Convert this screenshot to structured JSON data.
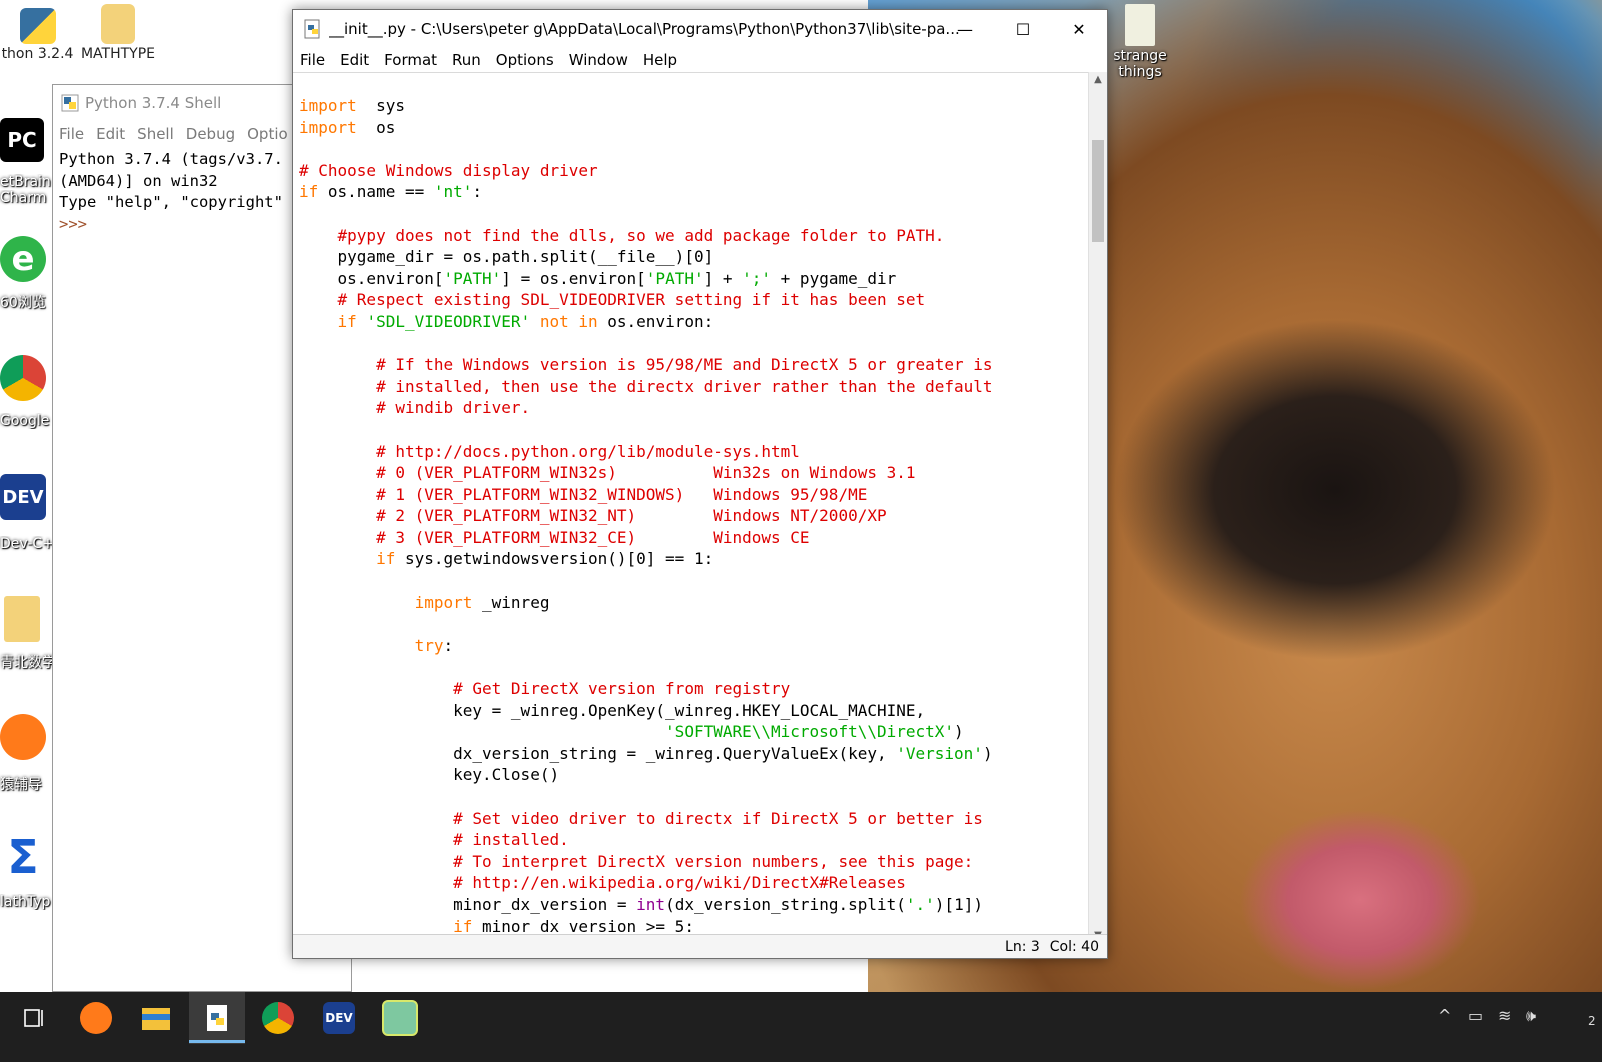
{
  "desktop": {
    "top_icons": [
      {
        "label": "thon 3.2.4",
        "icon": "python-icon"
      },
      {
        "label": "MATHTYPE",
        "icon": "folder-icon"
      }
    ],
    "right_icons": [
      {
        "label_line1": "strange",
        "label_line2": "things",
        "icon": "book-icon"
      }
    ],
    "left_icons": [
      {
        "label_line1": "etBrain",
        "label_line2": "Charm",
        "glyph": "PC",
        "icon": "pycharm-icon"
      },
      {
        "label_line1": "60浏览",
        "glyph": "e",
        "icon": "browser-360-icon"
      },
      {
        "label_line1": "Google",
        "icon": "chrome-icon"
      },
      {
        "label_line1": "Dev-C+",
        "glyph": "DEV",
        "icon": "devcpp-icon"
      },
      {
        "label_line1": "青北数学",
        "icon": "folder-icon"
      },
      {
        "label_line1": "猿辅导",
        "icon": "monkey-icon"
      },
      {
        "label_line1": "lathTyp",
        "glyph": "Σ",
        "icon": "mathtype-icon"
      }
    ]
  },
  "shell": {
    "title": "Python 3.7.4 Shell",
    "menu": [
      "File",
      "Edit",
      "Shell",
      "Debug",
      "Optio"
    ],
    "lines": [
      "Python 3.7.4 (tags/v3.7.",
      "(AMD64)] on win32",
      "Type \"help\", \"copyright\""
    ],
    "prompt": ">>>"
  },
  "editor": {
    "title": "__init__.py - C:\\Users\\peter g\\AppData\\Local\\Programs\\Python\\Python37\\lib\\site-pa...",
    "window_buttons": {
      "minimize": "—",
      "maximize": "☐",
      "close": "✕"
    },
    "menu": [
      "File",
      "Edit",
      "Format",
      "Run",
      "Options",
      "Window",
      "Help"
    ],
    "status": {
      "line": "Ln: 3",
      "col": "Col: 40"
    },
    "code": [
      [
        [
          "kw",
          "import"
        ],
        [
          "",
          "  sys"
        ]
      ],
      [
        [
          "kw",
          "import"
        ],
        [
          "",
          "  os"
        ]
      ],
      [],
      [
        [
          "cm",
          "# Choose Windows display driver"
        ]
      ],
      [
        [
          "kw",
          "if"
        ],
        [
          "",
          " os.name == "
        ],
        [
          "st",
          "'nt'"
        ],
        [
          "",
          ":"
        ]
      ],
      [],
      [
        [
          "",
          "    "
        ],
        [
          "cm",
          "#pypy does not find the dlls, so we add package folder to PATH."
        ]
      ],
      [
        [
          "",
          "    pygame_dir = os.path.split(__file__)[0]"
        ]
      ],
      [
        [
          "",
          "    os.environ["
        ],
        [
          "st",
          "'PATH'"
        ],
        [
          "",
          "] = os.environ["
        ],
        [
          "st",
          "'PATH'"
        ],
        [
          "",
          "] + "
        ],
        [
          "st",
          "';'"
        ],
        [
          "",
          " + pygame_dir"
        ]
      ],
      [
        [
          "",
          "    "
        ],
        [
          "cm",
          "# Respect existing SDL_VIDEODRIVER setting if it has been set"
        ]
      ],
      [
        [
          "",
          "    "
        ],
        [
          "kw",
          "if"
        ],
        [
          "",
          " "
        ],
        [
          "st",
          "'SDL_VIDEODRIVER'"
        ],
        [
          "",
          " "
        ],
        [
          "kw",
          "not in"
        ],
        [
          "",
          " os.environ:"
        ]
      ],
      [],
      [
        [
          "",
          "        "
        ],
        [
          "cm",
          "# If the Windows version is 95/98/ME and DirectX 5 or greater is"
        ]
      ],
      [
        [
          "",
          "        "
        ],
        [
          "cm",
          "# installed, then use the directx driver rather than the default"
        ]
      ],
      [
        [
          "",
          "        "
        ],
        [
          "cm",
          "# windib driver."
        ]
      ],
      [],
      [
        [
          "",
          "        "
        ],
        [
          "cm",
          "# http://docs.python.org/lib/module-sys.html"
        ]
      ],
      [
        [
          "",
          "        "
        ],
        [
          "cm",
          "# 0 (VER_PLATFORM_WIN32s)          Win32s on Windows 3.1"
        ]
      ],
      [
        [
          "",
          "        "
        ],
        [
          "cm",
          "# 1 (VER_PLATFORM_WIN32_WINDOWS)   Windows 95/98/ME"
        ]
      ],
      [
        [
          "",
          "        "
        ],
        [
          "cm",
          "# 2 (VER_PLATFORM_WIN32_NT)        Windows NT/2000/XP"
        ]
      ],
      [
        [
          "",
          "        "
        ],
        [
          "cm",
          "# 3 (VER_PLATFORM_WIN32_CE)        Windows CE"
        ]
      ],
      [
        [
          "",
          "        "
        ],
        [
          "kw",
          "if"
        ],
        [
          "",
          " sys.getwindowsversion()[0] == 1:"
        ]
      ],
      [],
      [
        [
          "",
          "            "
        ],
        [
          "kw",
          "import"
        ],
        [
          "",
          " _winreg"
        ]
      ],
      [],
      [
        [
          "",
          "            "
        ],
        [
          "kw",
          "try"
        ],
        [
          "",
          ":"
        ]
      ],
      [],
      [
        [
          "",
          "                "
        ],
        [
          "cm",
          "# Get DirectX version from registry"
        ]
      ],
      [
        [
          "",
          "                key = _winreg.OpenKey(_winreg.HKEY_LOCAL_MACHINE,"
        ]
      ],
      [
        [
          "",
          "                                      "
        ],
        [
          "st",
          "'SOFTWARE\\\\Microsoft\\\\DirectX'"
        ],
        [
          "",
          ")"
        ]
      ],
      [
        [
          "",
          "                dx_version_string = _winreg.QueryValueEx(key, "
        ],
        [
          "st",
          "'Version'"
        ],
        [
          "",
          ")"
        ]
      ],
      [
        [
          "",
          "                key.Close()"
        ]
      ],
      [],
      [
        [
          "",
          "                "
        ],
        [
          "cm",
          "# Set video driver to directx if DirectX 5 or better is"
        ]
      ],
      [
        [
          "",
          "                "
        ],
        [
          "cm",
          "# installed."
        ]
      ],
      [
        [
          "",
          "                "
        ],
        [
          "cm",
          "# To interpret DirectX version numbers, see this page:"
        ]
      ],
      [
        [
          "",
          "                "
        ],
        [
          "cm",
          "# http://en.wikipedia.org/wiki/DirectX#Releases"
        ]
      ],
      [
        [
          "",
          "                minor_dx_version = "
        ],
        [
          "bi",
          "int"
        ],
        [
          "",
          "(dx_version_string.split("
        ],
        [
          "st",
          "'.'"
        ],
        [
          "",
          ")[1])"
        ]
      ],
      [
        [
          "",
          "                "
        ],
        [
          "kw",
          "if"
        ],
        [
          "",
          " minor_dx_version >= 5:"
        ]
      ]
    ]
  },
  "taskbar": {
    "items": [
      {
        "name": "task-view-icon"
      },
      {
        "name": "monkey-app-icon"
      },
      {
        "name": "file-explorer-icon"
      },
      {
        "name": "python-idle-icon",
        "active": true
      },
      {
        "name": "chrome-icon"
      },
      {
        "name": "devcpp-icon",
        "glyph": "DEV"
      },
      {
        "name": "image-app-icon"
      }
    ],
    "tray": {
      "chevron": "^",
      "battery": "▭",
      "wifi": "≋",
      "volume": "🕪",
      "clock_fragment": "2"
    }
  },
  "colors": {
    "keyword": "#ff7700",
    "comment": "#dd0000",
    "string": "#00aa00",
    "builtin": "#900090",
    "taskbar": "#1f1f1f"
  }
}
